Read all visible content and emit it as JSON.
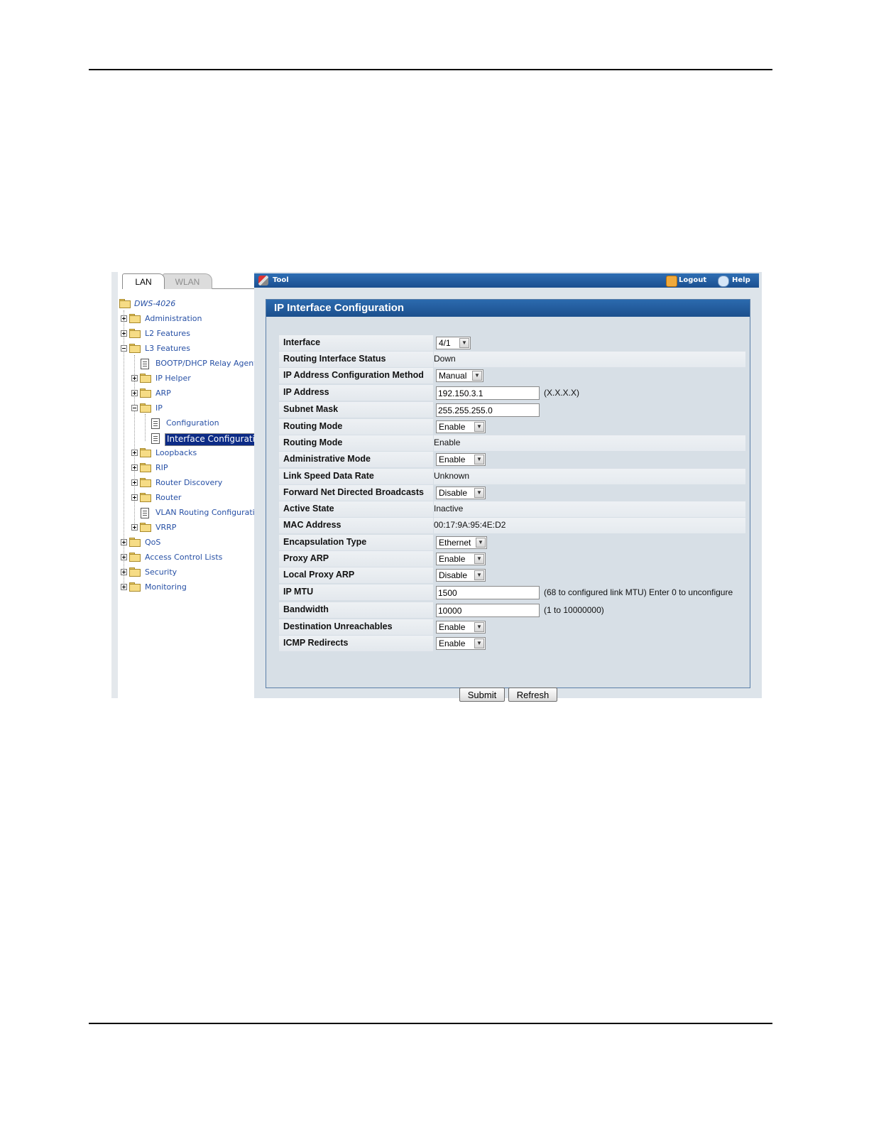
{
  "tabs": {
    "lan": "LAN",
    "wlan": "WLAN"
  },
  "toolbar": {
    "tool_label": "Tool",
    "logout_label": "Logout",
    "help_label": "Help"
  },
  "tree": {
    "root": "DWS-4026",
    "items": [
      {
        "label": "Administration"
      },
      {
        "label": "L2 Features"
      },
      {
        "label": "L3 Features"
      },
      {
        "label": "BOOTP/DHCP Relay Agent"
      },
      {
        "label": "IP Helper"
      },
      {
        "label": "ARP"
      },
      {
        "label": "IP"
      },
      {
        "label": "Configuration"
      },
      {
        "label": "Interface Configuration"
      },
      {
        "label": "Loopbacks"
      },
      {
        "label": "RIP"
      },
      {
        "label": "Router Discovery"
      },
      {
        "label": "Router"
      },
      {
        "label": "VLAN Routing Configuration"
      },
      {
        "label": "VRRP"
      },
      {
        "label": "QoS"
      },
      {
        "label": "Access Control Lists"
      },
      {
        "label": "Security"
      },
      {
        "label": "Monitoring"
      }
    ]
  },
  "panel": {
    "title": "IP Interface Configuration"
  },
  "form": {
    "rows": [
      {
        "label": "Interface",
        "value": "4/1"
      },
      {
        "label": "Routing Interface Status",
        "value": "Down"
      },
      {
        "label": "IP Address Configuration Method",
        "value": "Manual"
      },
      {
        "label": "IP Address",
        "value": "192.150.3.1",
        "hint": "(X.X.X.X)"
      },
      {
        "label": "Subnet Mask",
        "value": "255.255.255.0"
      },
      {
        "label": "Routing Mode",
        "value": "Enable"
      },
      {
        "label": "Routing Mode",
        "value": "Enable"
      },
      {
        "label": "Administrative Mode",
        "value": "Enable"
      },
      {
        "label": "Link Speed Data Rate",
        "value": "Unknown"
      },
      {
        "label": "Forward Net Directed Broadcasts",
        "value": "Disable"
      },
      {
        "label": "Active State",
        "value": "Inactive"
      },
      {
        "label": "MAC Address",
        "value": "00:17:9A:95:4E:D2"
      },
      {
        "label": "Encapsulation Type",
        "value": "Ethernet"
      },
      {
        "label": "Proxy ARP",
        "value": "Enable"
      },
      {
        "label": "Local Proxy ARP",
        "value": "Disable"
      },
      {
        "label": "IP MTU",
        "value": "1500",
        "hint": "(68 to configured link MTU) Enter 0 to unconfigure"
      },
      {
        "label": "Bandwidth",
        "value": "10000",
        "hint": "(1 to 10000000)"
      },
      {
        "label": "Destination Unreachables",
        "value": "Enable"
      },
      {
        "label": "ICMP Redirects",
        "value": "Enable"
      }
    ]
  },
  "buttons": {
    "submit": "Submit",
    "refresh": "Refresh"
  },
  "colors": {
    "header_blue": "#1c4f8d",
    "nav_link": "#2750a5",
    "selected_nav": "#0c2b86"
  }
}
